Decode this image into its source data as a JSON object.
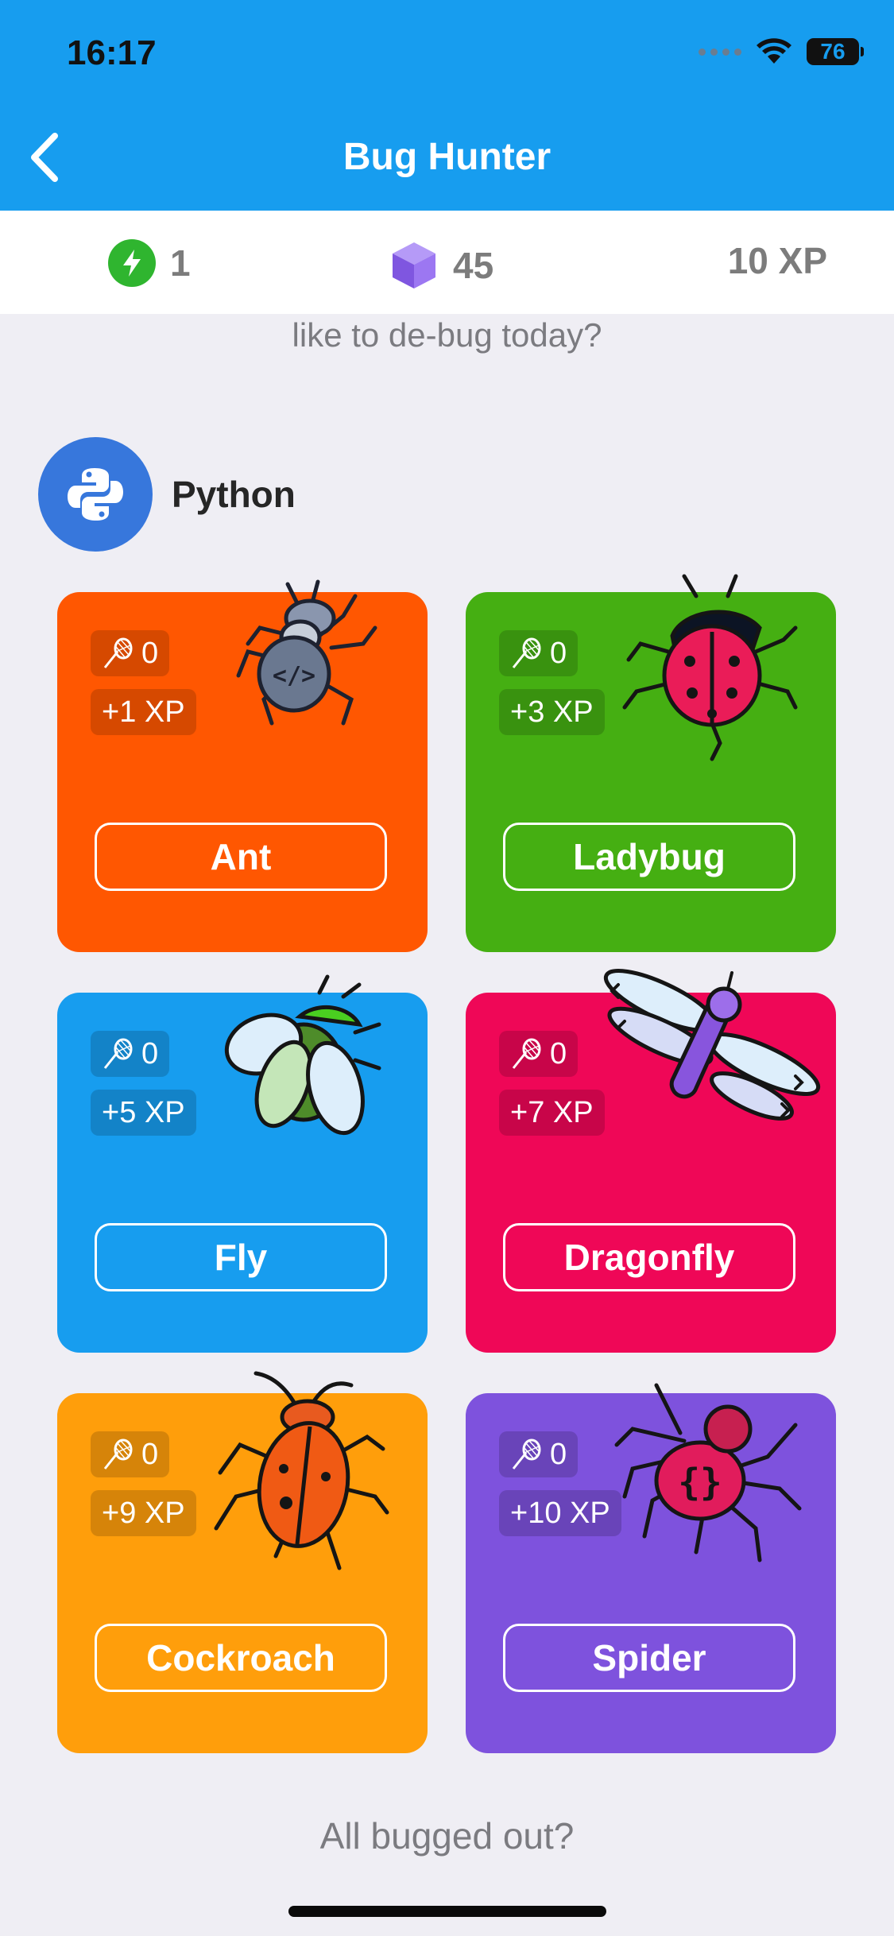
{
  "status_bar": {
    "time": "16:17",
    "battery": "76"
  },
  "header": {
    "title": "Bug Hunter"
  },
  "stats": {
    "energy": "1",
    "gems": "45",
    "xp": "10 XP"
  },
  "prompt": "like to de-bug today?",
  "language": {
    "name": "Python"
  },
  "cards": [
    {
      "name": "Ant",
      "nets": "0",
      "xp": "+1 XP",
      "color": "#FF5701"
    },
    {
      "name": "Ladybug",
      "nets": "0",
      "xp": "+3 XP",
      "color": "#45AF12"
    },
    {
      "name": "Fly",
      "nets": "0",
      "xp": "+5 XP",
      "color": "#179DEF"
    },
    {
      "name": "Dragonfly",
      "nets": "0",
      "xp": "+7 XP",
      "color": "#EF0757"
    },
    {
      "name": "Cockroach",
      "nets": "0",
      "xp": "+9 XP",
      "color": "#FF9E0B"
    },
    {
      "name": "Spider",
      "nets": "0",
      "xp": "+10 XP",
      "color": "#7E52DD"
    }
  ],
  "footer": "All bugged out?"
}
